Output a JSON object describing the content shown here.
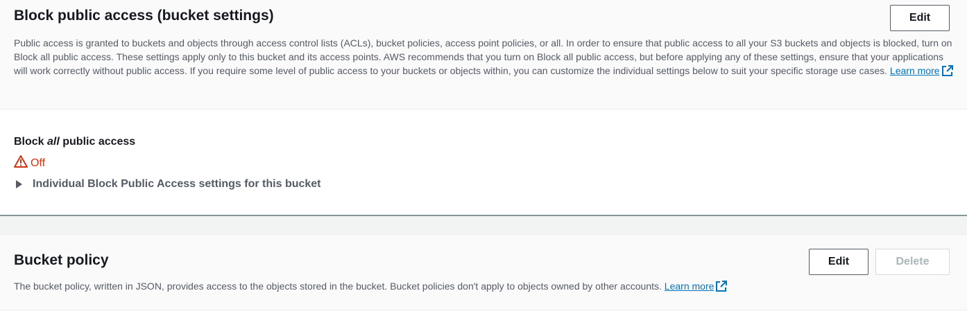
{
  "block_public_access": {
    "title": "Block public access (bucket settings)",
    "edit_label": "Edit",
    "description": "Public access is granted to buckets and objects through access control lists (ACLs), bucket policies, access point policies, or all. In order to ensure that public access to all your S3 buckets and objects is blocked, turn on Block all public access. These settings apply only to this bucket and its access points. AWS recommends that you turn on Block all public access, but before applying any of these settings, ensure that your applications will work correctly without public access. If you require some level of public access to your buckets or objects within, you can customize the individual settings below to suit your specific storage use cases.",
    "learn_more": "Learn more",
    "setting_label_prefix": "Block ",
    "setting_label_em": "all",
    "setting_label_suffix": " public access",
    "status": "Off",
    "status_icon": "warning-icon",
    "status_color": "#d13212",
    "expander_label": "Individual Block Public Access settings for this bucket"
  },
  "bucket_policy": {
    "title": "Bucket policy",
    "edit_label": "Edit",
    "delete_label": "Delete",
    "description": "The bucket policy, written in JSON, provides access to the objects stored in the bucket. Bucket policies don't apply to objects owned by other accounts.",
    "learn_more": "Learn more"
  },
  "colors": {
    "link": "#0073bb",
    "text": "#16191f",
    "muted_text": "#545b64",
    "disabled": "#aab7b8"
  }
}
